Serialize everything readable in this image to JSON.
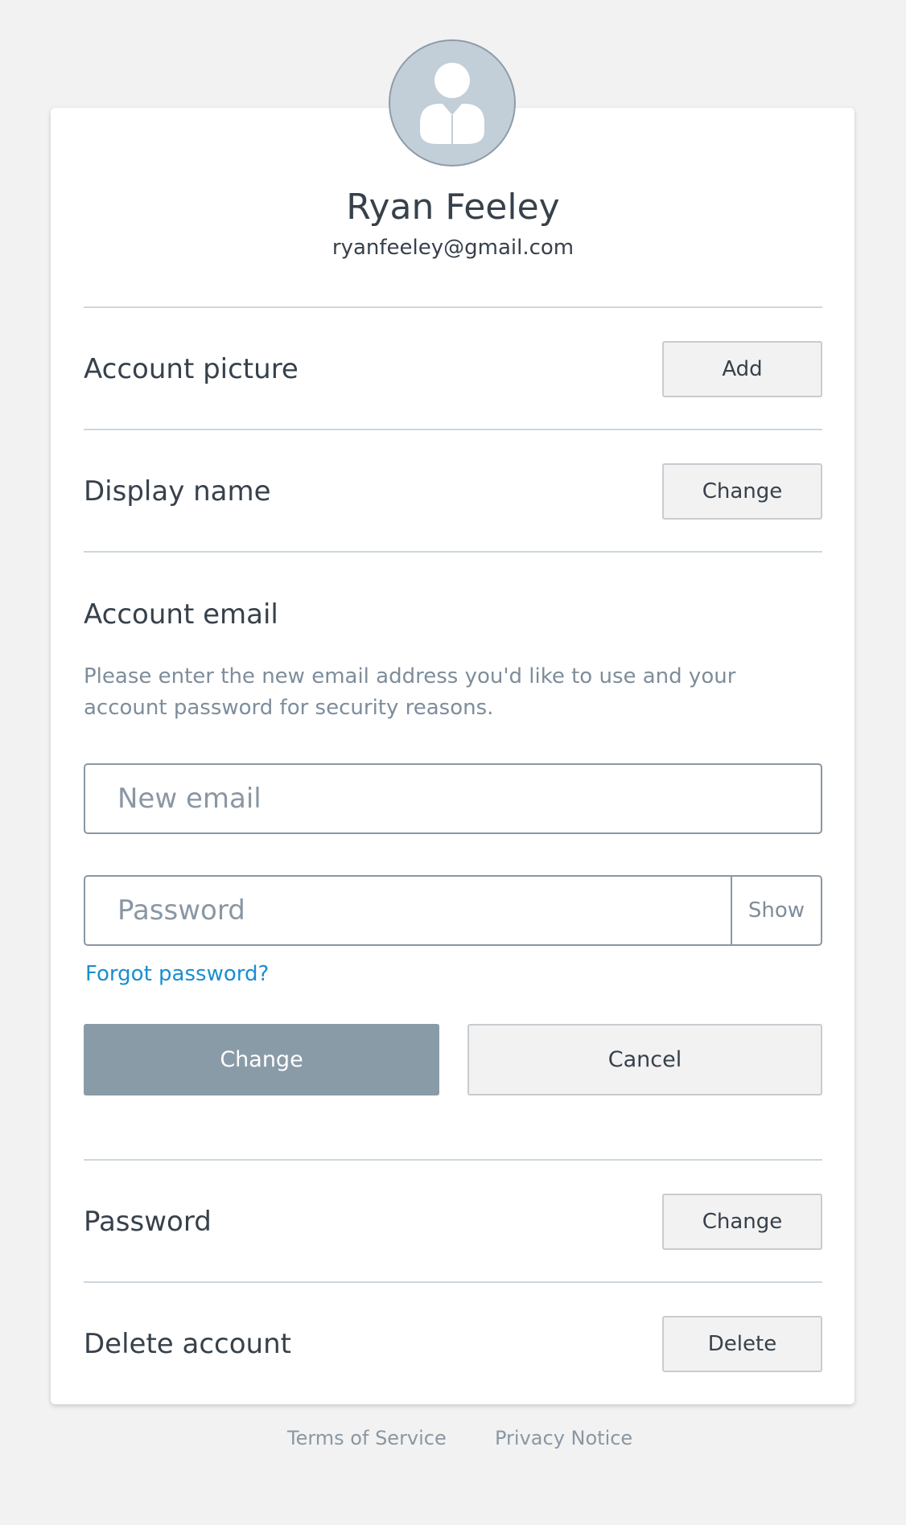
{
  "profile": {
    "name": "Ryan Feeley",
    "email": "ryanfeeley@gmail.com",
    "avatar_icon": "user-silhouette-icon"
  },
  "rows": {
    "account_picture": {
      "label": "Account picture",
      "button": "Add"
    },
    "display_name": {
      "label": "Display name",
      "button": "Change"
    },
    "password": {
      "label": "Password",
      "button": "Change"
    },
    "delete_account": {
      "label": "Delete account",
      "button": "Delete"
    }
  },
  "email_form": {
    "title": "Account email",
    "help": "Please enter the new email address you'd like to use and your account password for security reasons.",
    "new_email_placeholder": "New email",
    "new_email_value": "",
    "password_placeholder": "Password",
    "password_value": "",
    "show_label": "Show",
    "forgot_label": "Forgot password?",
    "submit_label": "Change",
    "cancel_label": "Cancel"
  },
  "footer": {
    "terms": "Terms of Service",
    "privacy": "Privacy Notice"
  },
  "colors": {
    "background": "#f2f2f2",
    "card": "#ffffff",
    "text": "#37414b",
    "muted": "#7e8d9b",
    "link": "#1a8ed0",
    "primary_button": "#8a9ba8",
    "avatar_fill": "#c2ced8"
  }
}
